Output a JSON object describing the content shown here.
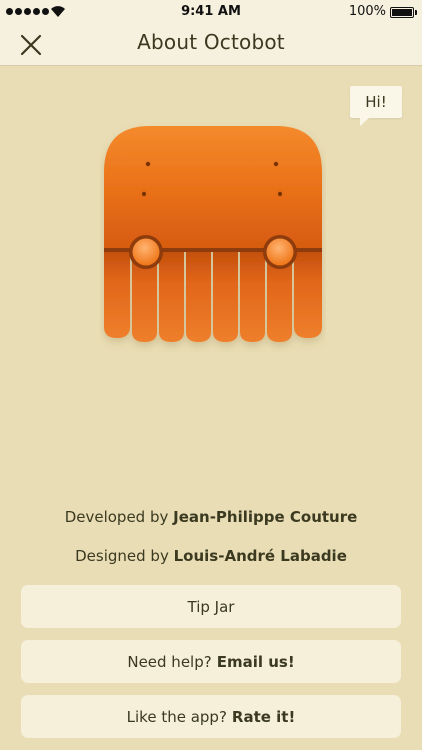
{
  "status_bar": {
    "time": "9:41 AM",
    "battery_percent": "100%",
    "signal_icon": "signal-dots-icon",
    "wifi_icon": "wifi-icon",
    "battery_icon": "battery-icon"
  },
  "nav": {
    "title": "About Octobot",
    "close_icon": "close-icon"
  },
  "bubble": {
    "text": "Hi!"
  },
  "credits": {
    "developed_prefix": "Developed by",
    "developer_name": "Jean-Philippe Couture",
    "designed_prefix": "Designed by",
    "designer_name": "Louis-André Labadie"
  },
  "buttons": {
    "tip_jar": "Tip Jar",
    "help_prefix": "Need help?",
    "help_action": "Email us!",
    "rate_prefix": "Like the app?",
    "rate_action": "Rate it!"
  },
  "colors": {
    "background": "#e9ddb5",
    "bar": "#f6f1de",
    "button": "#f6f0da",
    "octobot_orange": "#e76a17",
    "text": "#3b3a20"
  }
}
